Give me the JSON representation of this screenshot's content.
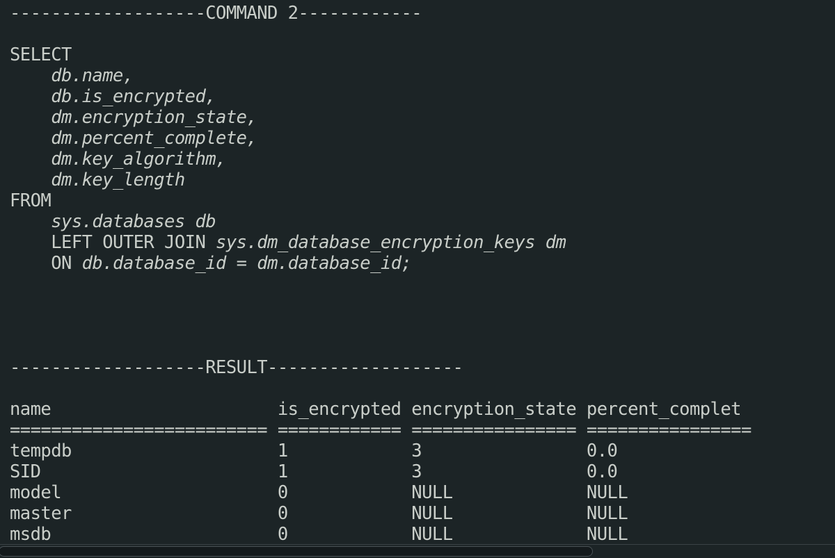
{
  "terminal": {
    "background_color": "#1c2426",
    "text_color": "#c9cec9",
    "command_banner": "-------------------COMMAND 2------------",
    "result_banner": "-------------------RESULT-------------------",
    "query": {
      "l1_select": "SELECT",
      "l2_col1": "    db.name,",
      "l3_col2": "    db.is_encrypted,",
      "l4_col3": "    dm.encryption_state,",
      "l5_col4": "    dm.percent_complete,",
      "l6_col5": "    dm.key_algorithm,",
      "l7_col6": "    dm.key_length",
      "l8_from": "FROM",
      "l9_table": "    sys.databases db",
      "l10_join_kw": "    LEFT OUTER JOIN ",
      "l10_join_ident": "sys.dm_database_encryption_keys dm",
      "l11_on_kw": "    ON ",
      "l11_on_ident": "db.database_id = dm.database_id;"
    },
    "result_table": {
      "header_line": "name                      is_encrypted encryption_state percent_complet",
      "separator_line": "========================= ============ ================ ================",
      "columns": [
        "name",
        "is_encrypted",
        "encryption_state",
        "percent_complet"
      ],
      "rows": [
        {
          "line": "tempdb                    1            3                0.0"
        },
        {
          "line": "SID                       1            3                0.0"
        },
        {
          "line": "model                     0            NULL             NULL"
        },
        {
          "line": "master                    0            NULL             NULL"
        },
        {
          "line": "msdb                      0            NULL             NULL"
        }
      ],
      "row_values": [
        [
          "tempdb",
          "1",
          "3",
          "0.0"
        ],
        [
          "SID",
          "1",
          "3",
          "0.0"
        ],
        [
          "model",
          "0",
          "NULL",
          "NULL"
        ],
        [
          "master",
          "0",
          "NULL",
          "NULL"
        ],
        [
          "msdb",
          "0",
          "NULL",
          "NULL"
        ]
      ]
    }
  },
  "scrollbar": {
    "orientation": "horizontal",
    "thumb_label": ""
  }
}
